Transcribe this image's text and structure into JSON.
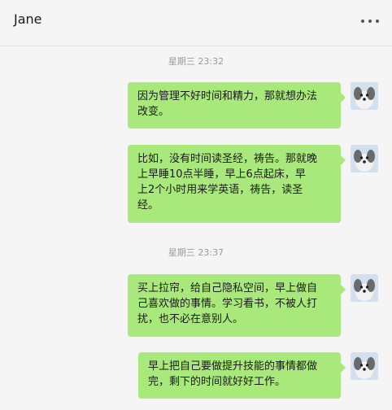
{
  "header": {
    "title": "Jane",
    "more_icon": "more-horizontal-icon"
  },
  "messages": {
    "ts1": "星期三 23:32",
    "msg1": "因为管理不好时间和精力，那就想办法\n改变。",
    "msg2": "比如，没有时间读圣经，祷告。那就晚\n上早睡10点半睡，早上6点起床，早\n上2个小时用来学英语，祷告，读圣\n经。",
    "ts2": "星期三 23:37",
    "msg3": "买上拉帘，给自己隐私空间，早上做自\n己喜欢做的事情。学习看书，不被人打\n扰，也不必在意别人。",
    "msg4": "早上把自己要做提升技能的事情都做\n完，剩下的时间就好好工作。"
  },
  "colors": {
    "bubble": "#a9e87a",
    "background": "#f5f5f5"
  }
}
